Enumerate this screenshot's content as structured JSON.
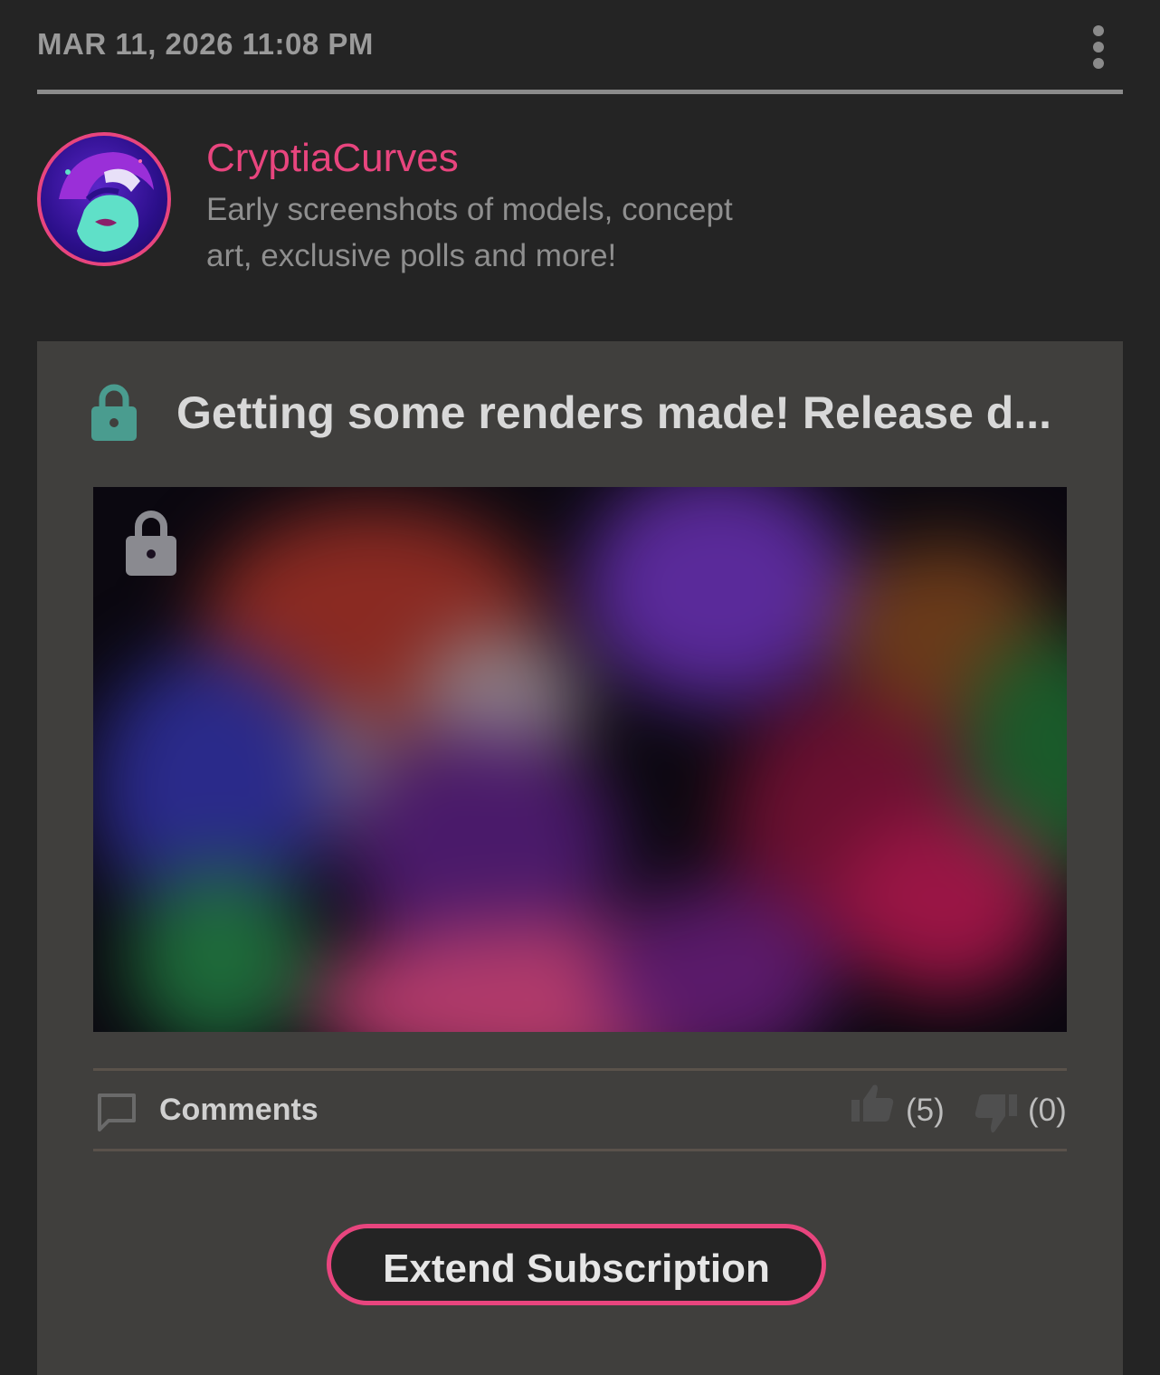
{
  "post": {
    "timestamp": "MAR 11, 2026 11:08 PM",
    "title": "Getting some renders made! Release d...",
    "locked": true
  },
  "creator": {
    "name": "CryptiaCurves",
    "tier_description": "Early screenshots of models, concept art, exclusive polls and more!"
  },
  "actions": {
    "comments_label": "Comments",
    "likes": "(5)",
    "dislikes": "(0)",
    "extend_button": "Extend Subscription"
  },
  "icons": {
    "menu": "more-vertical-icon",
    "title_lock": "lock-icon",
    "media_lock": "lock-icon",
    "comments": "comment-icon",
    "like": "thumbs-up-icon",
    "dislike": "thumbs-down-icon"
  },
  "colors": {
    "background": "#242424",
    "card": "#403f3d",
    "accent": "#e8457e",
    "lock_accent": "#4a9c8f",
    "muted_text": "#8f8f8f"
  }
}
